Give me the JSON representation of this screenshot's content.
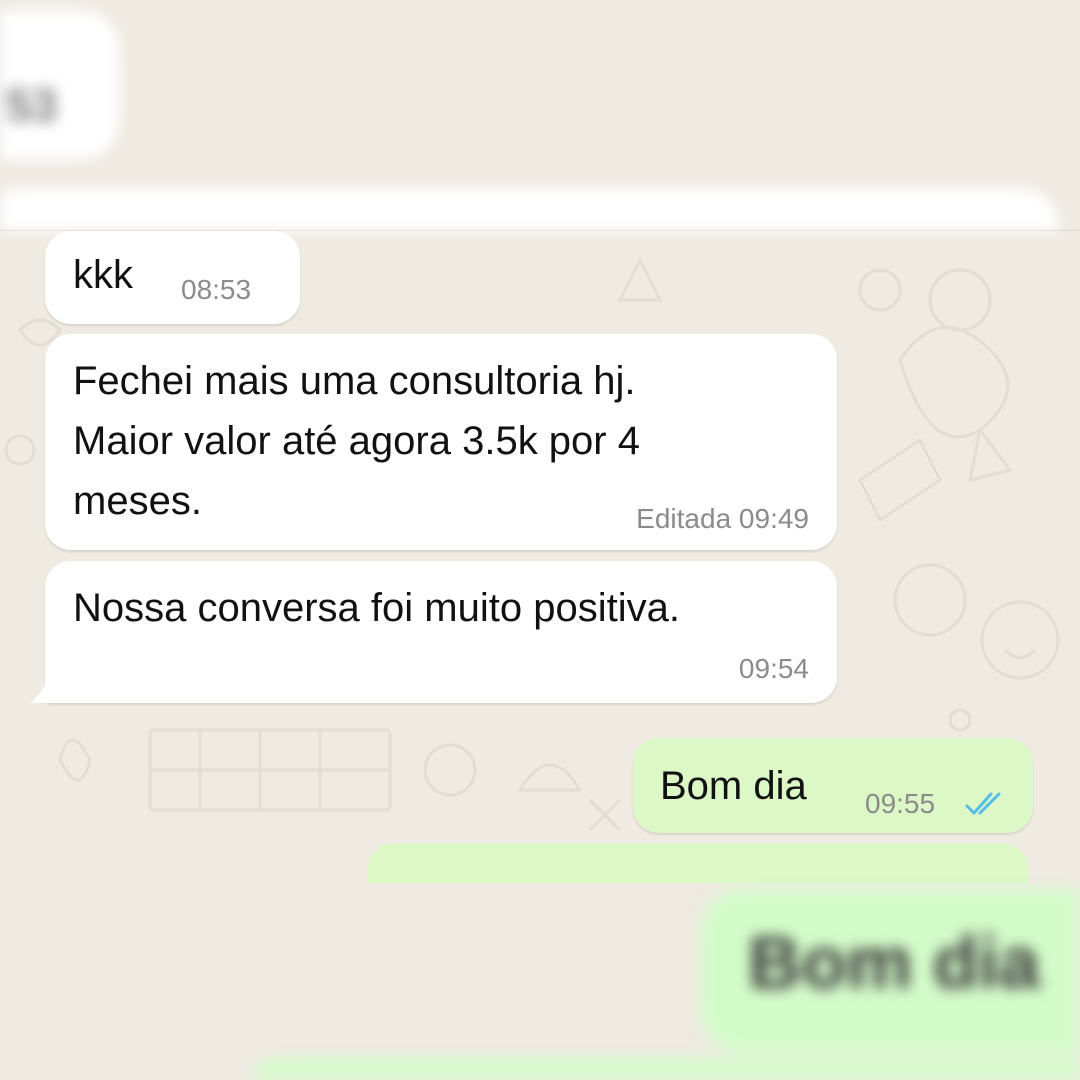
{
  "chat": {
    "background_color": "#efeae2",
    "incoming_bubble_color": "#ffffff",
    "outgoing_bubble_color": "#dcf8c6",
    "messages": [
      {
        "direction": "in",
        "text": "kkk",
        "time": "08:53",
        "edited": ""
      },
      {
        "direction": "in",
        "text": "Fechei mais uma consultoria hj.\nMaior valor até agora 3.5k por 4\nmeses.",
        "time": "09:49",
        "edited": "Editada"
      },
      {
        "direction": "in",
        "text": "Nossa conversa foi muito positiva.",
        "time": "09:54",
        "edited": ""
      },
      {
        "direction": "out",
        "text": "Bom dia",
        "time": "09:55",
        "edited": "",
        "status": "read",
        "status_icon": "double-check-icon",
        "status_color": "#53bdeb"
      }
    ]
  },
  "blurred_preview": {
    "top_time_fragment": "53",
    "bottom_text": "Bom dia"
  }
}
